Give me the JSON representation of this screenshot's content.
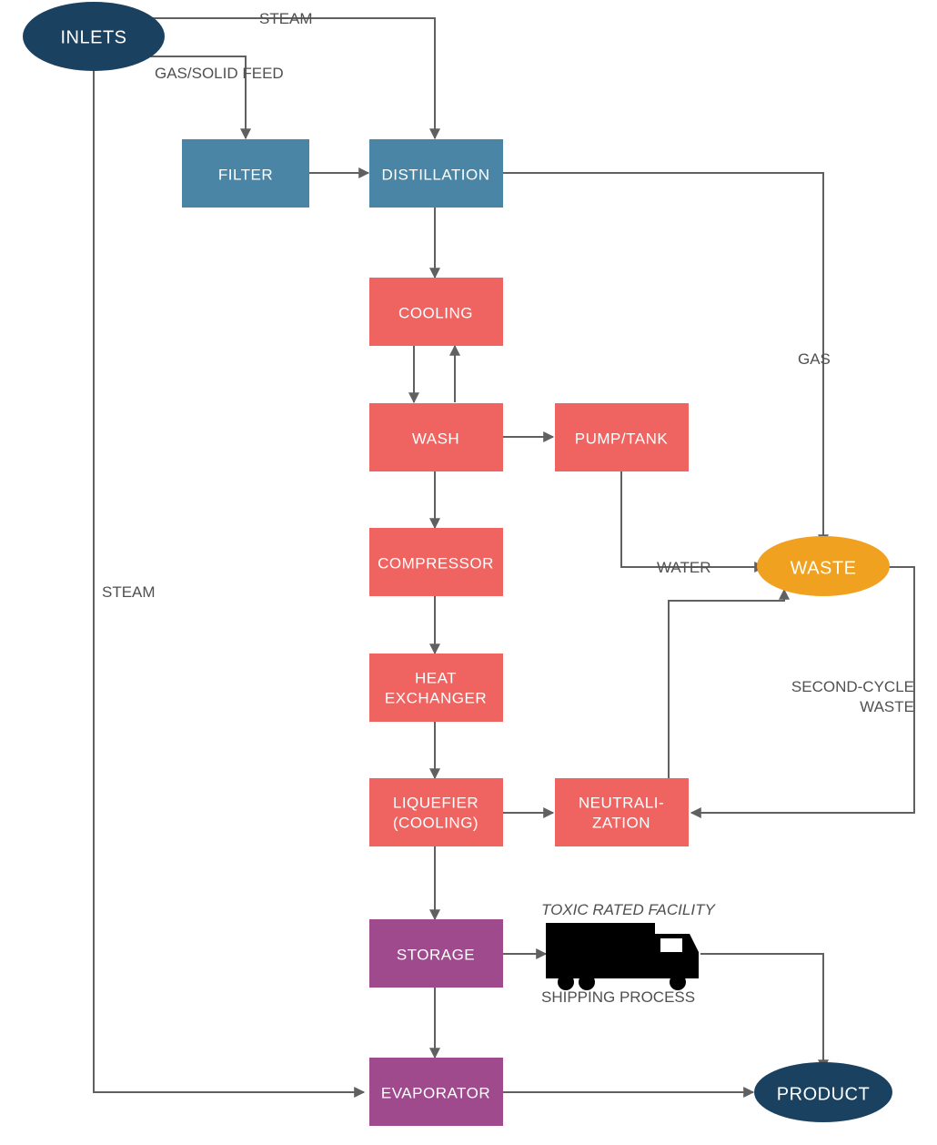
{
  "colors": {
    "navy": "#1a4160",
    "steel": "#4b85a5",
    "coral": "#ef6461",
    "plum": "#9e4a8d",
    "amber": "#f0a11f",
    "stroke": "#606060"
  },
  "nodes": {
    "inlets": "INLETS",
    "filter": "FILTER",
    "distillation": "DISTILLATION",
    "cooling": "COOLING",
    "wash": "WASH",
    "pumpTank": "PUMP/TANK",
    "compressor": "COMPRESSOR",
    "heatExchanger1": "HEAT",
    "heatExchanger2": "EXCHANGER",
    "liquefier1": "LIQUEFIER",
    "liquefier2": "(COOLING)",
    "neutralization1": "NEUTRALI-",
    "neutralization2": "ZATION",
    "storage": "STORAGE",
    "evaporator": "EVAPORATOR",
    "waste": "WASTE",
    "product": "PRODUCT"
  },
  "labels": {
    "steamTop": "STEAM",
    "gasSolidFeed": "GAS/SOLID FEED",
    "gas": "GAS",
    "water": "WATER",
    "secondCycle1": "SECOND-CYCLE",
    "secondCycle2": "WASTE",
    "steamLeft": "STEAM",
    "toxic": "TOXIC RATED FACILITY",
    "shipping": "SHIPPING PROCESS"
  }
}
